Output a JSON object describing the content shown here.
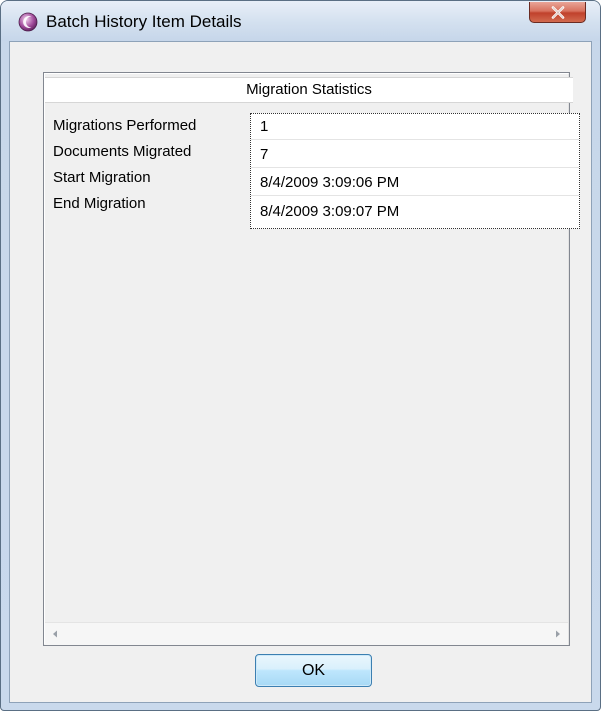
{
  "window": {
    "title": "Batch History Item Details",
    "icon": "app-logo-icon",
    "close_icon": "close-icon"
  },
  "section": {
    "title": "Migration Statistics"
  },
  "stats": [
    {
      "label": "Migrations Performed",
      "value": "1"
    },
    {
      "label": "Documents Migrated",
      "value": "7"
    },
    {
      "label": "Start Migration",
      "value": "8/4/2009 3:09:06 PM"
    },
    {
      "label": "End Migration",
      "value": "8/4/2009 3:09:07 PM"
    }
  ],
  "buttons": {
    "ok_label": "OK"
  },
  "colors": {
    "titlebar": "#d3e0ef",
    "close_button": "#c0412c",
    "client_bg": "#f0f0f0",
    "ok_button_border": "#3c7fb1"
  }
}
